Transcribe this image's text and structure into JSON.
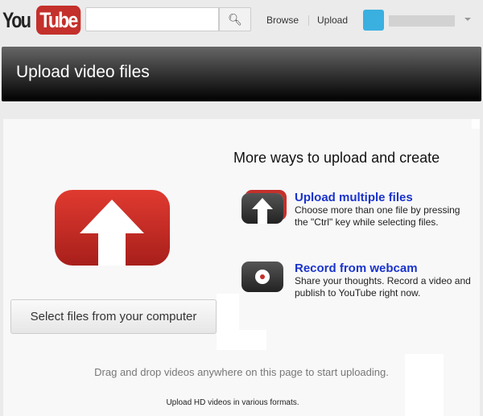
{
  "topbar": {
    "logo_you": "You",
    "logo_tube": "Tube",
    "search_placeholder": "",
    "browse": "Browse",
    "upload": "Upload"
  },
  "header": {
    "title": "Upload video files"
  },
  "main": {
    "select_button": "Select files from your computer",
    "more_title": "More ways to upload and create",
    "options": [
      {
        "title": "Upload multiple files",
        "desc": "Choose more than one file by pressing the \"Ctrl\" key while selecting files."
      },
      {
        "title": "Record from webcam",
        "desc": "Share your thoughts. Record a video and publish to YouTube right now."
      }
    ],
    "drag_text": "Drag and drop videos anywhere on this page to start uploading.",
    "hd_text": "Upload HD videos in various formats."
  },
  "colors": {
    "brand": "#c4302b",
    "link": "#1a33cc"
  }
}
